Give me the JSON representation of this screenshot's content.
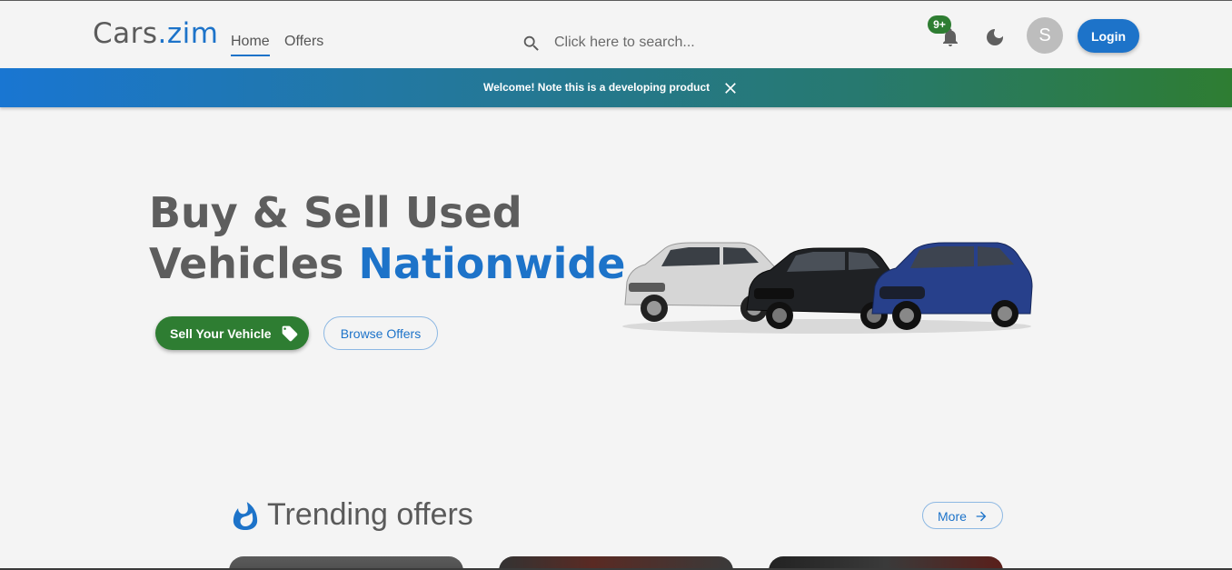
{
  "header": {
    "logo_main": "Cars",
    "logo_accent": ".zim",
    "nav": [
      {
        "label": "Home",
        "active": true
      },
      {
        "label": "Offers",
        "active": false
      }
    ],
    "search": {
      "placeholder": "Click here to search...",
      "icon": "search-icon"
    },
    "notifications": {
      "badge": "9+",
      "icon": "bell-icon"
    },
    "theme_toggle": {
      "icon": "moon-icon"
    },
    "avatar_initial": "S",
    "login_label": "Login"
  },
  "banner": {
    "text": "Welcome! Note this is a developing product",
    "close_icon": "close-icon",
    "colors": {
      "start": "#1976d2",
      "end": "#2e7d32"
    }
  },
  "hero": {
    "title_line1": "Buy & Sell Used",
    "title_line2_plain": "Vehicles ",
    "title_line2_accent": "Nationwide",
    "sell_label": "Sell Your Vehicle",
    "sell_icon": "tag-icon",
    "browse_label": "Browse Offers",
    "image": "three-suvs-image"
  },
  "trending": {
    "icon": "fire-icon",
    "title": "Trending offers",
    "more_label": "More",
    "more_icon": "arrow-right-icon",
    "cards": [
      {
        "id": "card-1"
      },
      {
        "id": "card-2"
      },
      {
        "id": "card-3"
      }
    ]
  },
  "colors": {
    "accent": "#1d73c9",
    "success": "#2e7d32",
    "background": "#f4f4f4"
  }
}
